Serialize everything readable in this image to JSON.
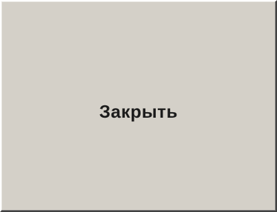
{
  "close_button": {
    "label": "Закрыть"
  },
  "colors": {
    "face": "#d4d0c8",
    "text": "#1c1c1c",
    "highlight": "#ffffff",
    "shadow": "#404040"
  }
}
